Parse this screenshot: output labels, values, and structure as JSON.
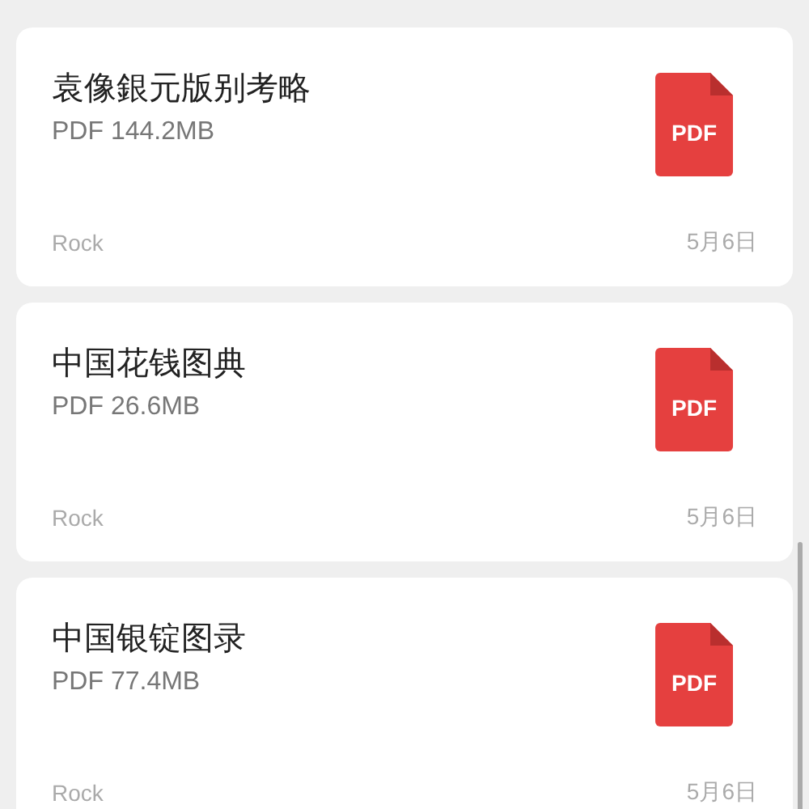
{
  "files": [
    {
      "title": "袁像銀元版别考略",
      "size": "PDF 144.2MB",
      "file_badge": "PDF",
      "owner": "Rock",
      "date": "5月6日"
    },
    {
      "title": "中国花钱图典",
      "size": "PDF 26.6MB",
      "file_badge": "PDF",
      "owner": "Rock",
      "date": "5月6日"
    },
    {
      "title": "中国银锭图录",
      "size": "PDF 77.4MB",
      "file_badge": "PDF",
      "owner": "Rock",
      "date": "5月6日"
    }
  ]
}
